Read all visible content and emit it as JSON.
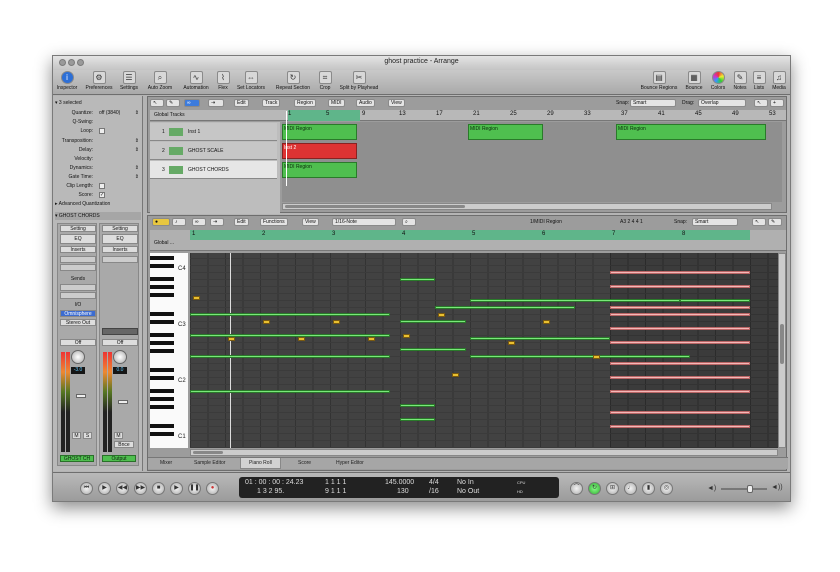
{
  "window": {
    "title": "ghost practice - Arrange"
  },
  "toolbar": {
    "items": [
      {
        "label": "Inspector",
        "icon": "info-icon"
      },
      {
        "label": "Preferences",
        "icon": "gear-icon"
      },
      {
        "label": "Settings",
        "icon": "sliders-icon"
      },
      {
        "label": "Auto Zoom",
        "icon": "zoom-icon"
      },
      {
        "label": "Automation",
        "icon": "automation-icon"
      },
      {
        "label": "Flex",
        "icon": "flex-icon"
      },
      {
        "label": "Set Locators",
        "icon": "locators-icon"
      },
      {
        "label": "Repeat Section",
        "icon": "repeat-icon"
      },
      {
        "label": "Crop",
        "icon": "crop-icon"
      },
      {
        "label": "Split by Playhead",
        "icon": "scissors-icon"
      },
      {
        "label": "Bounce Regions",
        "icon": "bounce-regions-icon"
      },
      {
        "label": "Bounce",
        "icon": "bounce-icon"
      },
      {
        "label": "Colors",
        "icon": "colors-icon"
      },
      {
        "label": "Notes",
        "icon": "notes-icon"
      },
      {
        "label": "Lists",
        "icon": "lists-icon"
      },
      {
        "label": "Media",
        "icon": "media-icon"
      }
    ]
  },
  "inspector": {
    "header": "3 selected",
    "rows": [
      {
        "label": "Quantize:",
        "value": "off (3840)"
      },
      {
        "label": "Q-Swing:",
        "value": ""
      },
      {
        "label": "Loop:",
        "value": ""
      },
      {
        "label": "Transposition:",
        "value": ""
      },
      {
        "label": "Delay:",
        "value": ""
      },
      {
        "label": "Velocity:",
        "value": ""
      },
      {
        "label": "Dynamics:",
        "value": ""
      },
      {
        "label": "Gate Time:",
        "value": ""
      },
      {
        "label": "Clip Length:",
        "value": ""
      },
      {
        "label": "Score:",
        "value": ""
      }
    ],
    "advanced": "Advanced Quantization",
    "track": "GHOST CHORDS",
    "strip_left": {
      "setting": "Setting",
      "eq": "EQ",
      "inserts": "Inserts",
      "sends": "Sends",
      "io": "I/O",
      "instrument": "Omnisphere",
      "output": "Stereo Out",
      "off": "Off",
      "pan": "-3.0",
      "mute": "M",
      "solo": "S",
      "name": "GHOST CH"
    },
    "strip_right": {
      "setting": "Setting",
      "eq": "EQ",
      "inserts": "Inserts",
      "off": "Off",
      "value": "0.0",
      "mute": "M",
      "bnce": "Bnce",
      "name": "Output"
    }
  },
  "arrange": {
    "menus": [
      "Edit",
      "Track",
      "Region",
      "MIDI",
      "Audio",
      "View"
    ],
    "snap_label": "Snap:",
    "snap_value": "Smart",
    "drag_label": "Drag:",
    "drag_value": "Overlap",
    "global_tracks": "Global Tracks",
    "bars": [
      "1",
      "5",
      "9",
      "13",
      "17",
      "21",
      "25",
      "29",
      "33",
      "37",
      "41",
      "45",
      "49",
      "53"
    ],
    "tracks": [
      {
        "num": "1",
        "name": "Inst 1"
      },
      {
        "num": "2",
        "name": "GHOST SCALE"
      },
      {
        "num": "3",
        "name": "GHOST CHORDS"
      }
    ],
    "regions": [
      {
        "label": "MIDI Region",
        "color": "#4fbf4f"
      },
      {
        "label": "Inst 2",
        "color": "#d33"
      },
      {
        "label": "MIDI Region",
        "color": "#4fbf4f"
      },
      {
        "label": "MIDI Region",
        "color": "#4fbf4f"
      },
      {
        "label": "MIDI Region",
        "color": "#4fbf4f"
      }
    ]
  },
  "editor": {
    "menus": [
      "Edit",
      "Functions",
      "View"
    ],
    "quantize": "1/16-Note",
    "region": "1/MIDI Region",
    "position": "A3  2 4 4 1",
    "snap_label": "Snap:",
    "snap_value": "Smart",
    "global": "Global ...",
    "bars": [
      "1",
      "2",
      "3",
      "4",
      "5",
      "6",
      "7",
      "8"
    ],
    "key_labels": [
      "C4",
      "C3",
      "C2",
      "C1"
    ]
  },
  "tabs": [
    "Mixer",
    "Sample Editor",
    "Piano Roll",
    "Score",
    "Hyper Editor"
  ],
  "active_tab": "Piano Roll",
  "transport": {
    "smpte": "01 : 00 : 00 : 24.23",
    "bbt": "1   3   2   95.",
    "loc1": "1   1   1   1",
    "loc2": "9   1   1   1",
    "tempo": "145.0000",
    "tempo2": "130",
    "sig": "4/4",
    "div": "/16",
    "in": "No In",
    "out": "No Out",
    "cpu": "CPU",
    "hd": "HD"
  }
}
